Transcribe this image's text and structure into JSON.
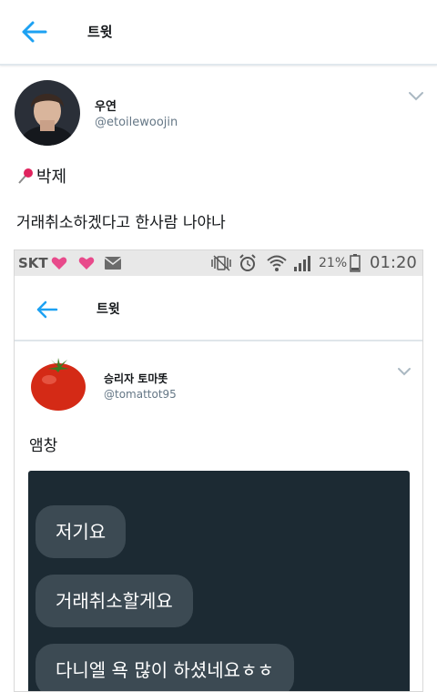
{
  "header": {
    "title": "트윗",
    "back_icon": "back-arrow-icon",
    "accent": "#1da1f2"
  },
  "tweet": {
    "user": {
      "name": "우연",
      "handle": "@etoilewoojin"
    },
    "line1": "박제",
    "line1_icon": "pushpin-icon",
    "line2": "거래취소하겠다고 한사람 나야나"
  },
  "embedded": {
    "status_bar": {
      "carrier": "SKT",
      "battery": "21%",
      "time": "01:20"
    },
    "header": {
      "title": "트윗"
    },
    "tweet": {
      "name": "승리자 토마똣",
      "handle": "@tomattot95",
      "text": "앰창"
    },
    "chat": {
      "messages": [
        "저기요",
        "거래취소할게요",
        "다니엘 욕 많이 하셨네요ㅎㅎ"
      ]
    }
  },
  "colors": {
    "chat_bg": "#1c2a33",
    "bubble_bg": "#3c4a53",
    "heart": "#e84a8b"
  }
}
